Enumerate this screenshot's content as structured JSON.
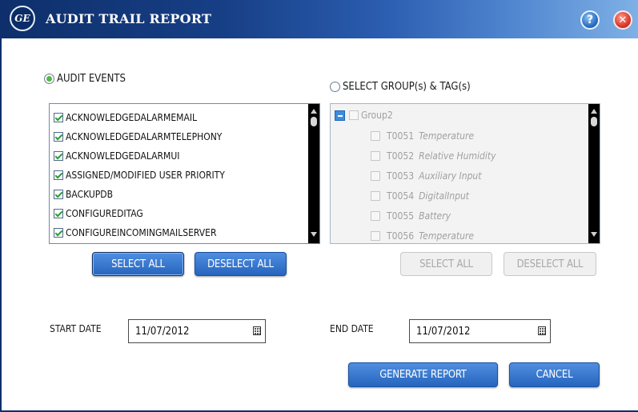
{
  "window": {
    "title": "AUDIT TRAIL REPORT",
    "logo_text": "GE",
    "help_glyph": "?",
    "close_glyph": "✕"
  },
  "audit_events": {
    "radio_label": "AUDIT EVENTS",
    "selected": true,
    "items": [
      {
        "label": "ACKNOWLEDGEDALARMEMAIL",
        "checked": true
      },
      {
        "label": "ACKNOWLEDGEDALARMTELEPHONY",
        "checked": true
      },
      {
        "label": "ACKNOWLEDGEDALARMUI",
        "checked": true
      },
      {
        "label": "ASSIGNED/MODIFIED USER PRIORITY",
        "checked": true
      },
      {
        "label": "BACKUPDB",
        "checked": true
      },
      {
        "label": "CONFIGUREDITAG",
        "checked": true
      },
      {
        "label": "CONFIGUREINCOMINGMAILSERVER",
        "checked": true
      }
    ],
    "select_all": "SELECT ALL",
    "deselect_all": "DESELECT ALL"
  },
  "groups_tags": {
    "radio_label": "SELECT GROUP(s) & TAG(s)",
    "selected": false,
    "group": "Group2",
    "tags": [
      {
        "code": "T0051",
        "desc": "Temperature"
      },
      {
        "code": "T0052",
        "desc": "Relative Humidity"
      },
      {
        "code": "T0053",
        "desc": "Auxiliary Input"
      },
      {
        "code": "T0054",
        "desc": "DigitalInput"
      },
      {
        "code": "T0055",
        "desc": "Battery"
      },
      {
        "code": "T0056",
        "desc": "Temperature"
      }
    ],
    "select_all": "SELECT ALL",
    "deselect_all": "DESELECT ALL"
  },
  "dates": {
    "start_label": "START DATE",
    "start_value": "11/07/2012",
    "end_label": "END DATE",
    "end_value": "11/07/2012"
  },
  "actions": {
    "generate": "GENERATE REPORT",
    "cancel": "CANCEL"
  },
  "colors": {
    "title_bar": "#0e2f6b",
    "button_blue": "#2f6fc9",
    "radio_selected": "#54b848"
  }
}
